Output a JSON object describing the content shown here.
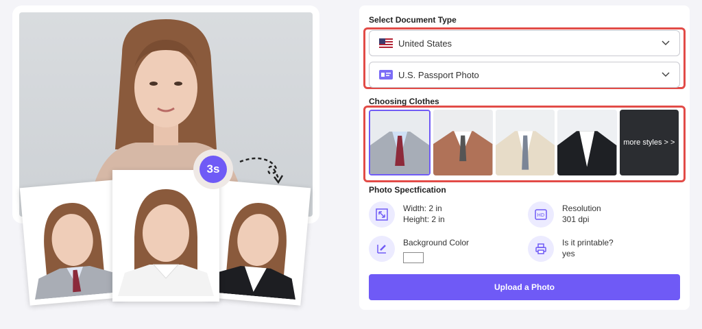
{
  "hero": {
    "timer_label": "3s"
  },
  "panel": {
    "document_type": {
      "title": "Select Document Type",
      "country": "United States",
      "document": "U.S. Passport Photo"
    },
    "clothes": {
      "title": "Choosing Clothes",
      "more_label": "more styles > >"
    },
    "spec": {
      "title": "Photo Spectfication",
      "width": "Width: 2 in",
      "height": "Height: 2 in",
      "resolution_label": "Resolution",
      "resolution_value": "301 dpi",
      "bg_label": "Background Color",
      "printable_label": "Is it printable?",
      "printable_value": "yes"
    },
    "upload_label": "Upload a Photo"
  },
  "colors": {
    "accent": "#6f5af6",
    "highlight": "#e24b47"
  }
}
